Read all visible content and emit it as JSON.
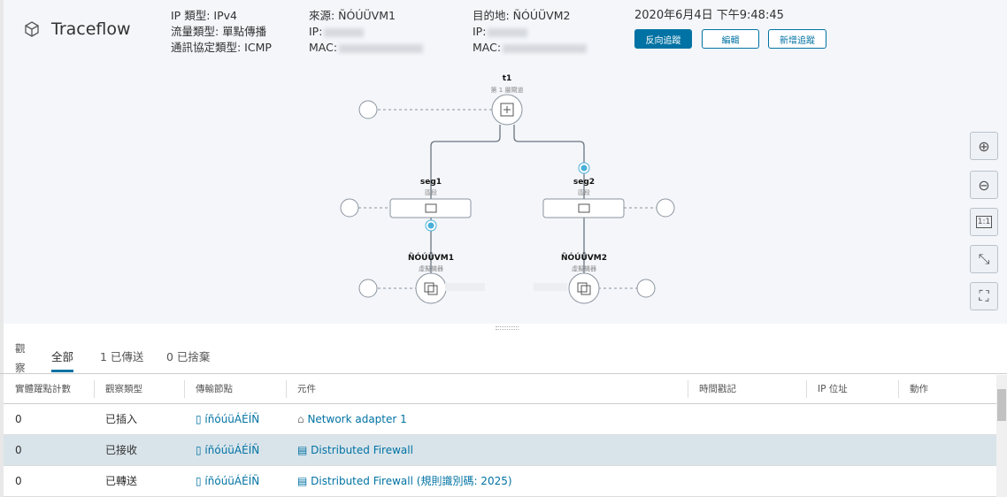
{
  "header": {
    "title": "Traceflow",
    "ip_type": "IP 類型: IPv4",
    "traffic_type": "流量類型: 單點傳播",
    "protocol": "通訊協定類型: ICMP",
    "source": "來源: ÑÓÚÜVM1",
    "source_ip": "IP:",
    "source_mac": "MAC:",
    "dest": "目的地: ÑÓÚÜVM2",
    "dest_ip": "IP:",
    "dest_mac": "MAC:",
    "timestamp": "2020年6月4日 下午9:48:45",
    "buttons": {
      "reverse": "反向追蹤",
      "edit": "編輯",
      "new": "新增追蹤"
    }
  },
  "topology": {
    "t1": {
      "name": "t1",
      "type": "第 1 層閘道"
    },
    "seg1": {
      "name": "seg1",
      "type": "區段"
    },
    "seg2": {
      "name": "seg2",
      "type": "區段"
    },
    "vm1": {
      "name": "ÑÓÚÜVM1",
      "type": "虛擬機器"
    },
    "vm2": {
      "name": "ÑÓÚÜVM2",
      "type": "虛擬機器"
    }
  },
  "zoom_controls": {
    "one_to_one": "1:1"
  },
  "observations": {
    "label": "觀察",
    "tabs": [
      "全部",
      "1 已傳送",
      "0 已捨棄"
    ],
    "columns": [
      "實體躍點計數",
      "觀察類型",
      "傳輸節點",
      "元件",
      "時間戳記",
      "IP 位址",
      "動作"
    ],
    "rows": [
      {
        "hop": "0",
        "type": "已插入",
        "node": "íñóúüÁÉÍÑ",
        "component": "Network adapter 1"
      },
      {
        "hop": "0",
        "type": "已接收",
        "node": "íñóúüÁÉÍÑ",
        "component": "Distributed Firewall"
      },
      {
        "hop": "0",
        "type": "已轉送",
        "node": "íñóúüÁÉÍÑ",
        "component": "Distributed Firewall (規則識別碼: 2025)"
      }
    ]
  },
  "colors": {
    "accent": "#0072a3",
    "selected_row": "#d9e4ea",
    "observation_dot": "#49afd9"
  }
}
